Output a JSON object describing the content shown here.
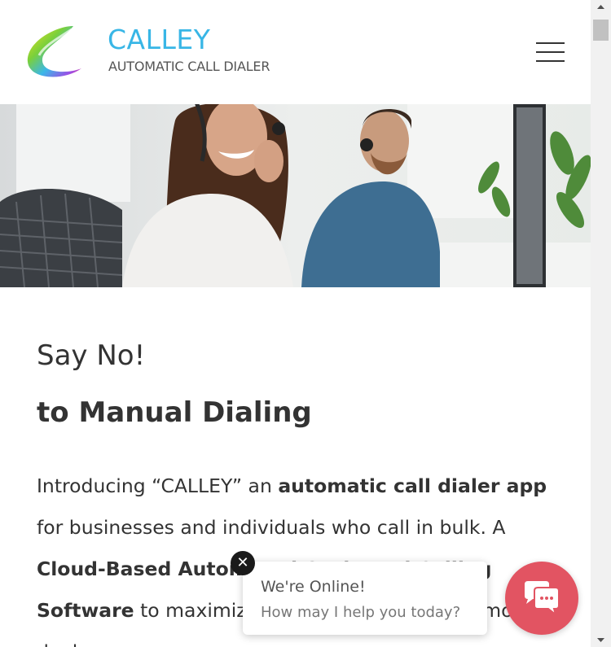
{
  "header": {
    "brand_name": "CALLEY",
    "brand_tagline": "AUTOMATIC CALL DIALER",
    "menu_icon": "hamburger-menu-icon"
  },
  "hero": {
    "icon": "hero-photo"
  },
  "main": {
    "headline_line1": "Say No!",
    "headline_line2_prefix": "to ",
    "headline_line2_bold": "Manual Dialing",
    "intro": {
      "part1": "Introducing “CALLEY” an ",
      "part2_bold": "automatic call dialer app",
      "part3": " for businesses and individuals who call in bulk. A ",
      "part4_bold": "Cloud-Based Automated Outbound Calling Software",
      "part5": " to maximize productivity and close more deals."
    }
  },
  "chat": {
    "title": "We're Online!",
    "subtitle": "How may I help you today?",
    "close_icon": "close-icon",
    "launcher_icon": "chat-icon"
  },
  "colors": {
    "brand_blue": "#38b6e6",
    "chat_red": "#e25462"
  }
}
